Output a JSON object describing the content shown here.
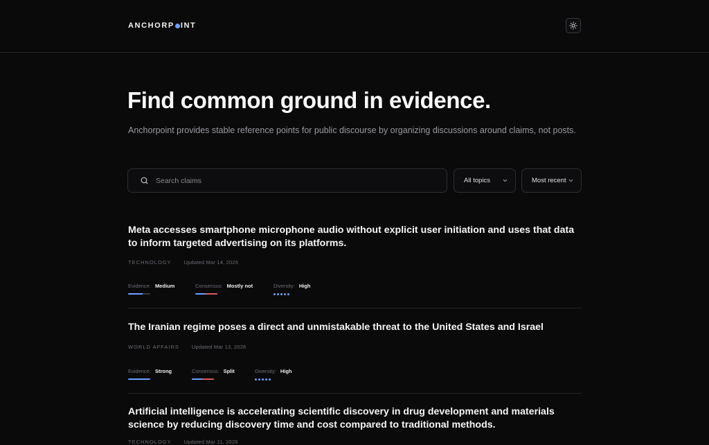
{
  "header": {
    "brand_left": "ANCHORP",
    "brand_right": "INT",
    "theme_toggle_icon": "sun-icon"
  },
  "hero": {
    "title": "Find common ground in evidence.",
    "subtitle": "Anchorpoint provides stable reference points for public discourse by organizing discussions around claims, not posts."
  },
  "search": {
    "placeholder": "Search claims",
    "value": ""
  },
  "filters": {
    "topics": "All topics",
    "sort": "Most recent"
  },
  "labels": {
    "evidence": "Evidence:",
    "consensus": "Consensus:",
    "diversity": "Diversity:"
  },
  "claims": [
    {
      "title": "Meta accesses smartphone microphone audio without explicit user initiation and uses that data to inform targeted advertising on its platforms.",
      "topic": "TECHNOLOGY",
      "updated": "Updated Mar 14, 2026",
      "evidence": "Medium",
      "consensus": "Mostly not",
      "diversity": "High",
      "evidence_level": 0.65,
      "diversity_dots": 5
    },
    {
      "title": "The Iranian regime poses a direct and unmistakable threat to the United States and Israel",
      "topic": "WORLD AFFAIRS",
      "updated": "Updated Mar 13, 2026",
      "evidence": "Strong",
      "consensus": "Split",
      "diversity": "High",
      "evidence_level": 1.0,
      "diversity_dots": 5
    },
    {
      "title": "Artificial intelligence is accelerating scientific discovery in drug development and materials science by reducing discovery time and cost compared to traditional methods.",
      "topic": "TECHNOLOGY",
      "updated": "Updated Mar 11, 2026"
    }
  ],
  "colors": {
    "accent": "#6aa2ff",
    "negative": "#e05a5a",
    "background": "#0a0a0b"
  }
}
